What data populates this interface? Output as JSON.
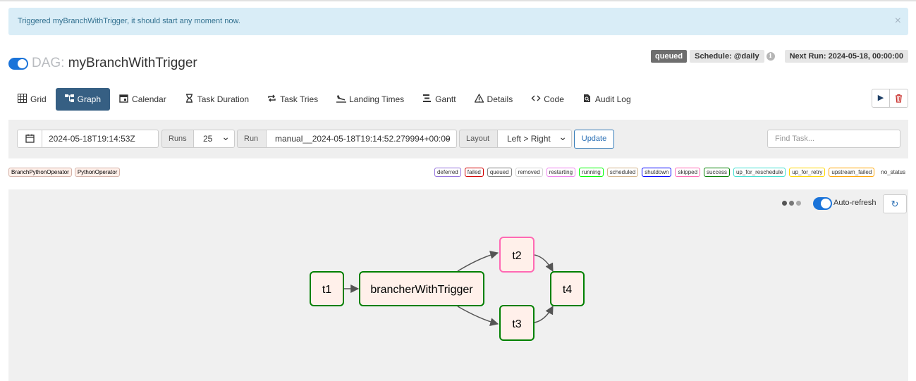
{
  "alert": {
    "message": "Triggered myBranchWithTrigger, it should start any moment now.",
    "close": "×"
  },
  "dag": {
    "prefix": "DAG:",
    "name": "myBranchWithTrigger"
  },
  "header": {
    "state": "queued",
    "schedule": "Schedule: @daily",
    "info": "i",
    "next_run": "Next Run: 2024-05-18, 00:00:00"
  },
  "tabs": [
    {
      "label": "Grid",
      "icon": "grid-icon"
    },
    {
      "label": "Graph",
      "icon": "graph-icon",
      "active": true
    },
    {
      "label": "Calendar",
      "icon": "calendar-icon"
    },
    {
      "label": "Task Duration",
      "icon": "hourglass-icon"
    },
    {
      "label": "Task Tries",
      "icon": "repeat-icon"
    },
    {
      "label": "Landing Times",
      "icon": "plane-landing-icon"
    },
    {
      "label": "Gantt",
      "icon": "gantt-icon"
    },
    {
      "label": "Details",
      "icon": "warning-triangle-icon"
    },
    {
      "label": "Code",
      "icon": "code-icon"
    },
    {
      "label": "Audit Log",
      "icon": "file-search-icon"
    }
  ],
  "actions": {
    "play": "▶",
    "delete": "🗑"
  },
  "filters": {
    "datetime": "2024-05-18T19:14:53Z",
    "runs_label": "Runs",
    "runs_value": "25",
    "run_label": "Run",
    "run_value": "manual__2024-05-18T19:14:52.279994+00:00",
    "layout_label": "Layout",
    "layout_value": "Left > Right",
    "update": "Update",
    "find_placeholder": "Find Task..."
  },
  "operators": [
    "BranchPythonOperator",
    "PythonOperator"
  ],
  "states": [
    {
      "label": "deferred",
      "color": "#9370db"
    },
    {
      "label": "failed",
      "color": "#d00000"
    },
    {
      "label": "queued",
      "color": "#808080"
    },
    {
      "label": "removed",
      "color": "#d3d3d3"
    },
    {
      "label": "restarting",
      "color": "#ee82ee"
    },
    {
      "label": "running",
      "color": "#00ff00"
    },
    {
      "label": "scheduled",
      "color": "#d2b48c"
    },
    {
      "label": "shutdown",
      "color": "#0000ff"
    },
    {
      "label": "skipped",
      "color": "#ff69b4"
    },
    {
      "label": "success",
      "color": "#008000"
    },
    {
      "label": "up_for_reschedule",
      "color": "#40e0d0"
    },
    {
      "label": "up_for_retry",
      "color": "#ffd700"
    },
    {
      "label": "upstream_failed",
      "color": "#ffa500"
    },
    {
      "label": "no_status",
      "color": ""
    }
  ],
  "graph": {
    "auto_refresh": "Auto-refresh",
    "refresh_icon": "↻",
    "nodes": [
      {
        "id": "t1",
        "label": "t1",
        "color": "#008000"
      },
      {
        "id": "brancherWithTrigger",
        "label": "brancherWithTrigger",
        "color": "#008000"
      },
      {
        "id": "t2",
        "label": "t2",
        "color": "#ff69b4"
      },
      {
        "id": "t3",
        "label": "t3",
        "color": "#008000"
      },
      {
        "id": "t4",
        "label": "t4",
        "color": "#008000"
      }
    ]
  },
  "colors": {
    "accent": "#365f83",
    "toggle": "#1a73d9",
    "success": "#008000",
    "skipped": "#ff69b4"
  }
}
